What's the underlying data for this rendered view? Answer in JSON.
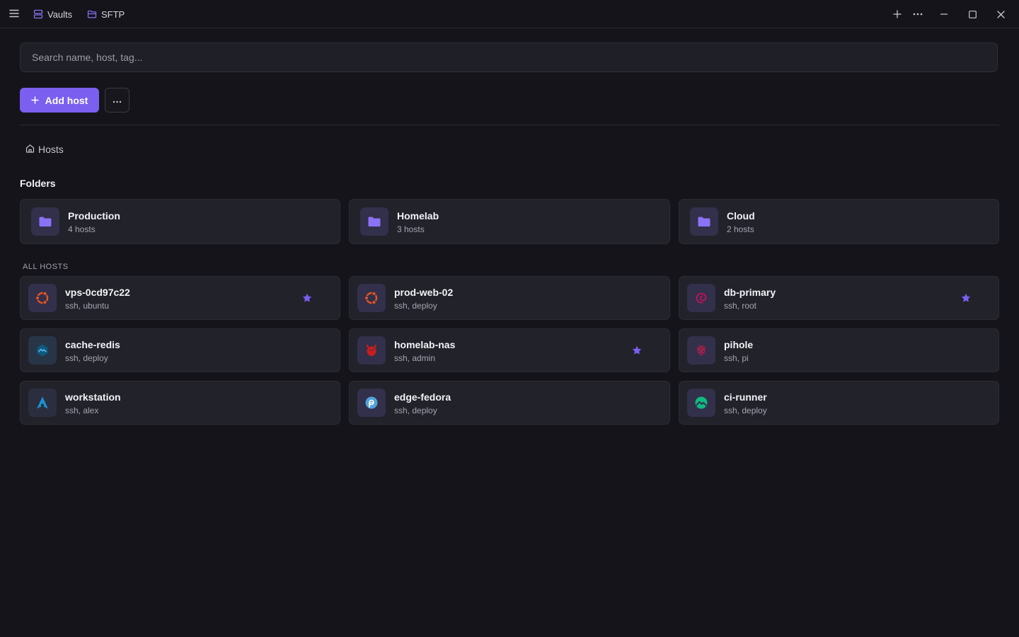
{
  "titlebar": {
    "tabs": [
      {
        "label": "Vaults",
        "icon": "server-stack-icon"
      },
      {
        "label": "SFTP",
        "icon": "folder-open-icon"
      }
    ]
  },
  "search": {
    "placeholder": "Search name, host, tag..."
  },
  "toolbar": {
    "add_host_label": "Add host"
  },
  "breadcrumb": {
    "label": "Hosts"
  },
  "folders_section": {
    "title": "Folders",
    "items": [
      {
        "name": "Production",
        "count": "4 hosts"
      },
      {
        "name": "Homelab",
        "count": "3 hosts"
      },
      {
        "name": "Cloud",
        "count": "2 hosts"
      }
    ]
  },
  "hosts_section": {
    "title": "ALL HOSTS",
    "items": [
      {
        "name": "vps-0cd97c22",
        "detail": "ssh, ubuntu",
        "os": "ubuntu",
        "starred": true
      },
      {
        "name": "prod-web-02",
        "detail": "ssh, deploy",
        "os": "ubuntu",
        "starred": false
      },
      {
        "name": "db-primary",
        "detail": "ssh, root",
        "os": "debian",
        "starred": true
      },
      {
        "name": "cache-redis",
        "detail": "ssh, deploy",
        "os": "alpine",
        "starred": false
      },
      {
        "name": "homelab-nas",
        "detail": "ssh, admin",
        "os": "freebsd",
        "starred": true
      },
      {
        "name": "pihole",
        "detail": "ssh, pi",
        "os": "raspberry-pi",
        "starred": false
      },
      {
        "name": "workstation",
        "detail": "ssh, alex",
        "os": "arch",
        "starred": false
      },
      {
        "name": "edge-fedora",
        "detail": "ssh, deploy",
        "os": "fedora",
        "starred": false
      },
      {
        "name": "ci-runner",
        "detail": "ssh, deploy",
        "os": "rocky",
        "starred": false
      }
    ]
  },
  "colors": {
    "accent": "#7a5ff0",
    "background": "#14141a",
    "card": "#22222b"
  }
}
